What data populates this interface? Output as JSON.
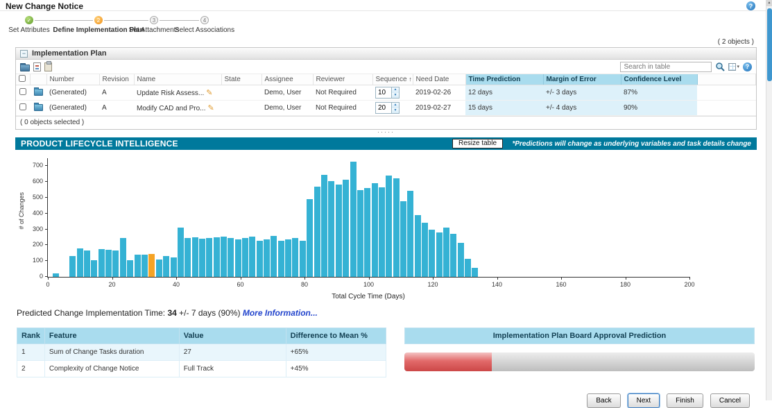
{
  "window": {
    "title": "New Change Notice"
  },
  "stepper": {
    "steps": [
      {
        "label": "Set Attributes",
        "glyph": "✓",
        "state": "complete"
      },
      {
        "label": "Define Implementation Plan",
        "glyph": "2",
        "state": "current"
      },
      {
        "label": "Set Attachments",
        "glyph": "3",
        "state": "upcoming"
      },
      {
        "label": "Select Associations",
        "glyph": "4",
        "state": "upcoming"
      }
    ]
  },
  "plan_panel": {
    "title": "Implementation Plan",
    "objects_count": "( 2 objects )",
    "selected_count": "( 0 objects selected )",
    "search_placeholder": "Search in table",
    "columns": {
      "number": "Number",
      "revision": "Revision",
      "name": "Name",
      "state": "State",
      "assignee": "Assignee",
      "reviewer": "Reviewer",
      "sequence": "Sequence",
      "sort_indicator": "↑",
      "need_date": "Need Date",
      "time_prediction": "Time Prediction",
      "margin_of_error": "Margin of Error",
      "confidence_level": "Confidence Level"
    },
    "rows": [
      {
        "number": "(Generated)",
        "revision": "A",
        "name": "Update Risk Assess...",
        "state": "",
        "assignee": "Demo, User",
        "reviewer": "Not Required",
        "sequence": "10",
        "need_date": "2019-02-26",
        "time_prediction": "12 days",
        "margin_of_error": "+/- 3 days",
        "confidence": "87%"
      },
      {
        "number": "(Generated)",
        "revision": "A",
        "name": "Modify CAD and Pro...",
        "state": "",
        "assignee": "Demo, User",
        "reviewer": "Not Required",
        "sequence": "20",
        "need_date": "2019-02-27",
        "time_prediction": "15 days",
        "margin_of_error": "+/- 4 days",
        "confidence": "90%"
      }
    ]
  },
  "pli": {
    "banner_title": "PRODUCT LIFECYCLE INTELLIGENCE",
    "resize_button": "Resize table",
    "disclaimer": "*Predictions will change as underlying variables and task details change"
  },
  "chart_data": {
    "type": "bar",
    "title": "",
    "xlabel": "Total Cycle Time (Days)",
    "ylabel": "# of Changes",
    "xlim": [
      0,
      200
    ],
    "ylim": [
      0,
      750
    ],
    "x_ticks": [
      0,
      20,
      40,
      60,
      80,
      100,
      120,
      140,
      160,
      180,
      200
    ],
    "y_ticks": [
      0,
      100,
      200,
      300,
      400,
      500,
      600,
      700
    ],
    "bar_color": "#35b2d4",
    "highlight_color": "#f5a325",
    "highlight_index": 12,
    "bin_width_days": 2.25,
    "x": [
      1.5,
      6.8,
      9.0,
      11.2,
      13.5,
      15.7,
      18.0,
      20.2,
      22.5,
      24.7,
      27.0,
      29.2,
      31.4,
      33.7,
      35.9,
      38.2,
      40.4,
      42.6,
      44.9,
      47.1,
      49.4,
      51.6,
      53.8,
      56.1,
      58.3,
      60.6,
      62.8,
      65.0,
      67.3,
      69.5,
      71.8,
      74.0,
      76.2,
      78.5,
      80.7,
      83.0,
      85.2,
      87.4,
      89.7,
      91.9,
      94.2,
      96.4,
      98.6,
      100.9,
      103.1,
      105.4,
      107.6,
      109.8,
      112.1,
      114.3,
      116.6,
      118.8,
      121.0,
      123.3,
      125.5,
      127.8,
      130.0,
      132.2
    ],
    "values": [
      20,
      130,
      180,
      165,
      105,
      175,
      170,
      165,
      245,
      105,
      140,
      140,
      145,
      110,
      130,
      125,
      310,
      245,
      250,
      240,
      245,
      250,
      255,
      245,
      235,
      245,
      255,
      230,
      235,
      260,
      230,
      235,
      245,
      230,
      490,
      570,
      645,
      605,
      585,
      615,
      730,
      550,
      560,
      590,
      565,
      640,
      625,
      480,
      545,
      390,
      340,
      300,
      280,
      310,
      270,
      215,
      115,
      55
    ],
    "grid": false,
    "legend": "none"
  },
  "prediction": {
    "prefix": "Predicted Change Implementation Time: ",
    "value": "34",
    "suffix": " +/- 7 days (90%) ",
    "link_label": "More Information..."
  },
  "feature_table": {
    "headers": [
      "Rank",
      "Feature",
      "Value",
      "Difference to Mean %"
    ],
    "rows": [
      {
        "rank": "1",
        "feature": "Sum of Change Tasks duration",
        "value": "27",
        "diff": "+65%"
      },
      {
        "rank": "2",
        "feature": "Complexity of Change Notice",
        "value": "Full Track",
        "diff": "+45%"
      }
    ]
  },
  "approval": {
    "title": "Implementation Plan Board Approval Prediction",
    "progress_percent": 25
  },
  "footer_buttons": [
    "Back",
    "Next",
    "Finish",
    "Cancel"
  ],
  "colors": {
    "banner_teal": "#00799c",
    "bar_cyan": "#35b2d4",
    "bar_highlight_orange": "#f5a325",
    "header_blue": "#a9dcee",
    "cell_blue": "#ddf1fa",
    "progress_red": "#cc4747",
    "link_blue": "#2244cc",
    "step_complete_green": "#5f9a28",
    "step_current_orange": "#ef8e12"
  }
}
